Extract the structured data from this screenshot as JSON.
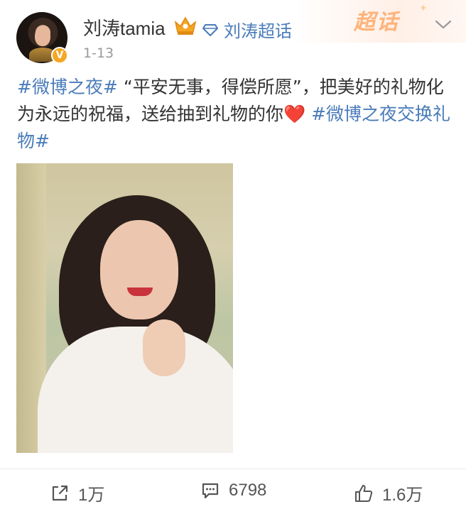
{
  "post": {
    "username": "刘涛tamia",
    "chaohua_link": "刘涛超话",
    "timestamp": "1-13",
    "chaohua_logo": "超话",
    "text": {
      "topic1": "#微博之夜#",
      "body": " “平安无事，得偿所愿”，把美好的礼物化为永远的祝福，送给抽到礼物的你",
      "heart": "❤️",
      "topic2": " #微博之夜交换礼物#"
    }
  },
  "actions": {
    "repost_count": "1万",
    "comment_count": "6798",
    "like_count": "1.6万"
  },
  "colors": {
    "link": "#4a7cb9",
    "verified": "#f5a623",
    "chaohua": "#ffb37a",
    "heart": "#e02c3c"
  },
  "icons": [
    "avatar",
    "verified-badge-icon",
    "crown-icon",
    "diamond-icon",
    "chevron-down-icon",
    "repost-icon",
    "comment-icon",
    "like-icon"
  ]
}
